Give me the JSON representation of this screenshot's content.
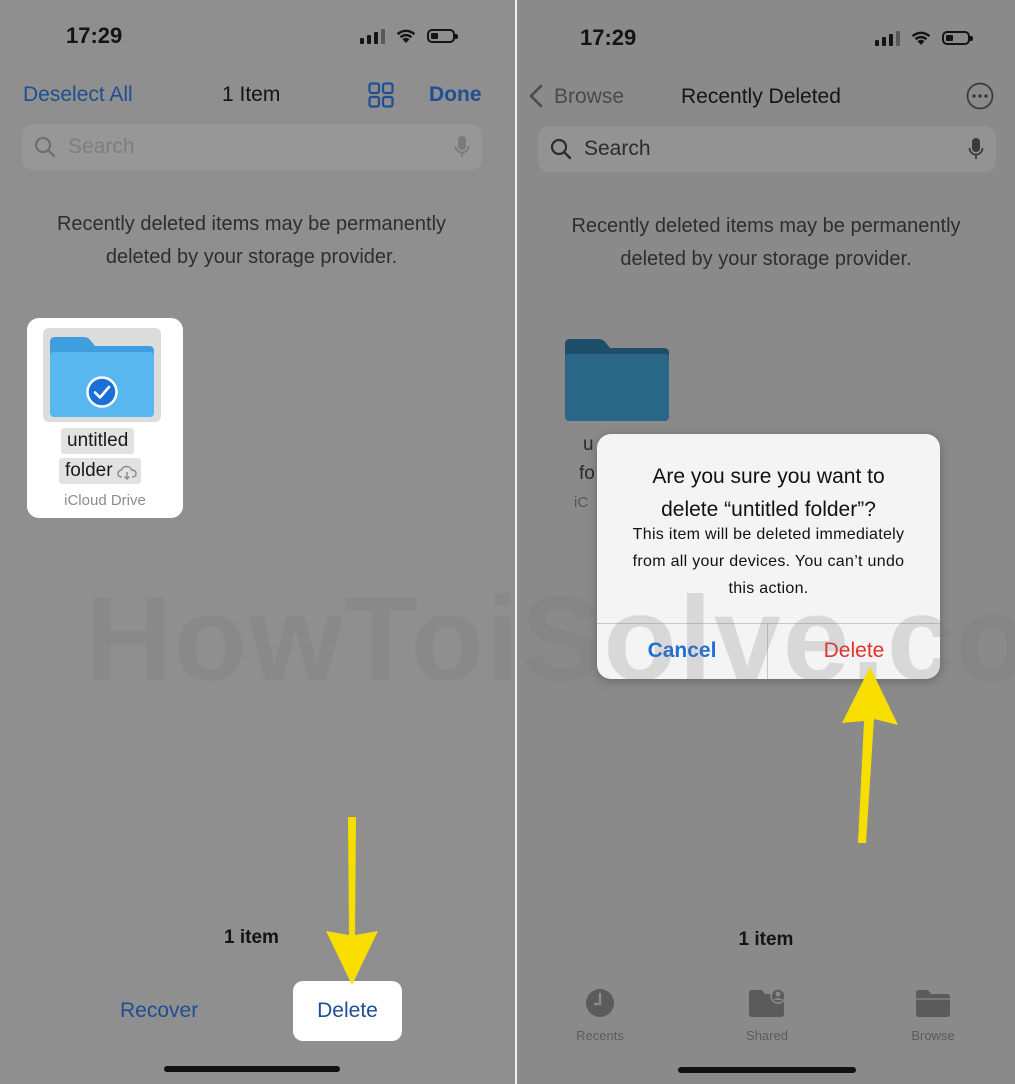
{
  "colors": {
    "accent": "#1f6fd8",
    "nav_blue": "#1f4e94",
    "destructive": "#e5302a",
    "folder": "#4db0ea",
    "arrow": "#f7de00"
  },
  "left": {
    "status": {
      "time": "17:29"
    },
    "nav": {
      "left_link": "Deselect All",
      "title": "1 Item",
      "grid_icon": "grid-icon",
      "right_link": "Done"
    },
    "search": {
      "placeholder": "Search"
    },
    "notice": {
      "line1": "Recently deleted items may be permanently",
      "line2": "deleted by your storage provider."
    },
    "file": {
      "name_line1": "untitled",
      "name_line2": "folder",
      "source": "iCloud Drive",
      "selected": true
    },
    "count": "1 item",
    "bottom": {
      "recover": "Recover",
      "delete": "Delete"
    }
  },
  "right": {
    "status": {
      "time": "17:29"
    },
    "nav": {
      "back": "Browse",
      "title": "Recently Deleted",
      "more_icon": "ellipsis-circle-icon"
    },
    "search": {
      "placeholder": "Search"
    },
    "notice": {
      "line1": "Recently deleted items may be permanently",
      "line2": "deleted by your storage provider."
    },
    "file": {
      "name_frag1": "u",
      "name_frag2": "fo",
      "source_frag": "iC"
    },
    "dialog": {
      "title_line1": "Are you sure you want to",
      "title_line2": "delete “untitled folder”?",
      "msg_line1": "This item will be deleted immediately",
      "msg_line2": "from all your devices. You can’t undo",
      "msg_line3": "this action.",
      "cancel": "Cancel",
      "delete": "Delete"
    },
    "count": "1 item",
    "tabs": [
      {
        "label": "Recents",
        "icon": "clock-icon"
      },
      {
        "label": "Shared",
        "icon": "shared-folder-icon"
      },
      {
        "label": "Browse",
        "icon": "folder-icon"
      }
    ]
  },
  "watermark": "HowToiSolve.com"
}
